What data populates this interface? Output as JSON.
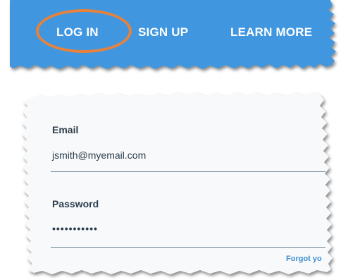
{
  "colors": {
    "nav_background": "#4097e0",
    "highlight_ring": "#e8823a",
    "form_background": "#f7f9fa",
    "link": "#3f8fd6",
    "text": "#2d3d4b"
  },
  "nav": {
    "items": [
      {
        "label": "LOG IN",
        "highlighted": true
      },
      {
        "label": "SIGN UP",
        "highlighted": false
      },
      {
        "label": "LEARN MORE",
        "highlighted": false
      }
    ]
  },
  "form": {
    "email": {
      "label": "Email",
      "value": "jsmith@myemail.com"
    },
    "password": {
      "label": "Password",
      "value": "•••••••••••"
    },
    "forgot_link": "Forgot yo"
  }
}
